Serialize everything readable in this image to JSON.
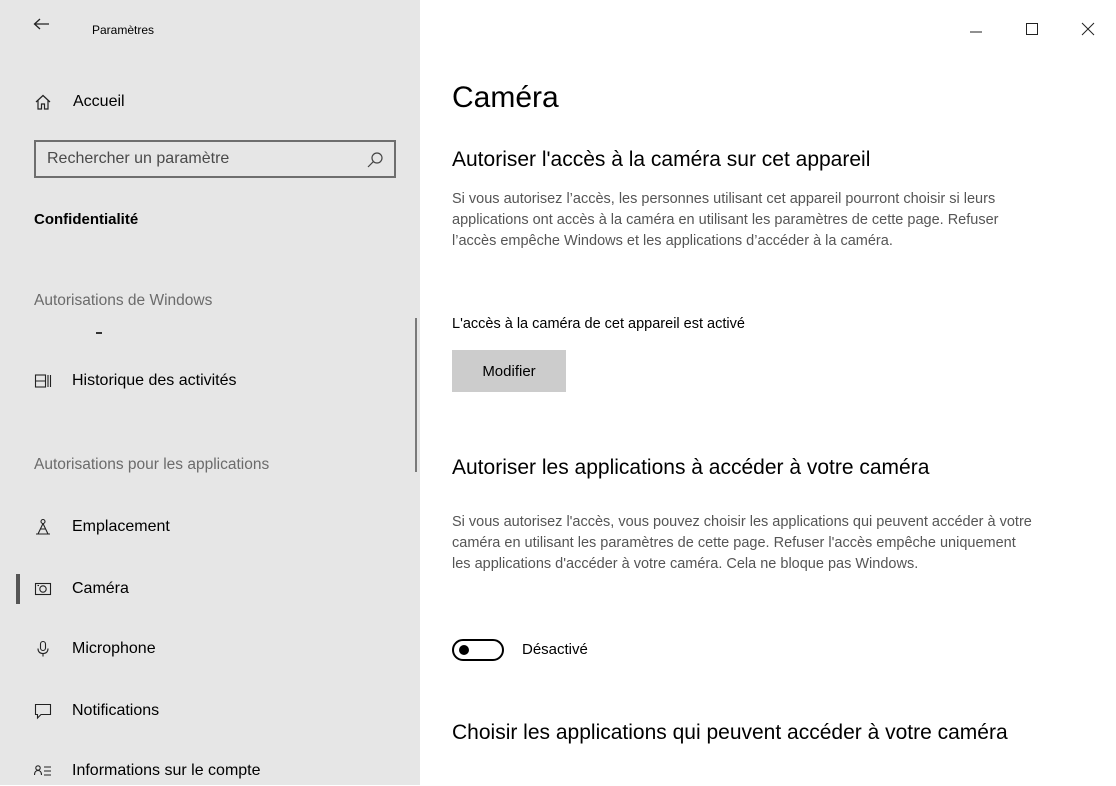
{
  "window": {
    "app_title": "Paramètres",
    "back_icon": "back-arrow-icon",
    "controls": {
      "minimize_icon": "minimize-icon",
      "maximize_icon": "maximize-icon",
      "close_icon": "close-icon"
    }
  },
  "sidebar": {
    "home": {
      "label": "Accueil",
      "icon": "home-icon"
    },
    "search": {
      "placeholder": "Rechercher un paramètre",
      "value": "",
      "icon": "search-icon"
    },
    "section_title": "Confidentialité",
    "windows_permissions": {
      "header": "Autorisations de Windows",
      "items": [
        {
          "label": "Historique des activités",
          "icon": "activity-history-icon"
        }
      ]
    },
    "app_permissions": {
      "header": "Autorisations pour les applications",
      "items": [
        {
          "label": "Emplacement",
          "icon": "location-icon"
        },
        {
          "label": "Caméra",
          "icon": "camera-icon",
          "active": true
        },
        {
          "label": "Microphone",
          "icon": "microphone-icon"
        },
        {
          "label": "Notifications",
          "icon": "notifications-icon"
        },
        {
          "label": "Informations sur le compte",
          "icon": "account-info-icon"
        }
      ]
    }
  },
  "main": {
    "title": "Caméra",
    "device_access": {
      "heading": "Autoriser l'accès à la caméra sur cet appareil",
      "description": "Si vous autorisez l’accès, les personnes utilisant cet appareil pourront choisir si leurs applications ont accès à la caméra en utilisant les paramètres de cette page. Refuser l’accès empêche Windows et les applications d’accéder à la caméra.",
      "status": "L'accès à la caméra de cet appareil est activé",
      "button_label": "Modifier"
    },
    "app_access": {
      "heading": "Autoriser les applications à accéder à votre caméra",
      "description": "Si vous autorisez l'accès, vous pouvez choisir les applications qui peuvent accéder à votre caméra en utilisant les paramètres de cette page. Refuser l'accès empêche uniquement les applications d'accéder à votre caméra. Cela ne bloque pas Windows.",
      "toggle_on": false,
      "toggle_label": "Désactivé"
    },
    "choose_apps": {
      "heading": "Choisir les applications qui peuvent accéder à votre caméra"
    }
  }
}
